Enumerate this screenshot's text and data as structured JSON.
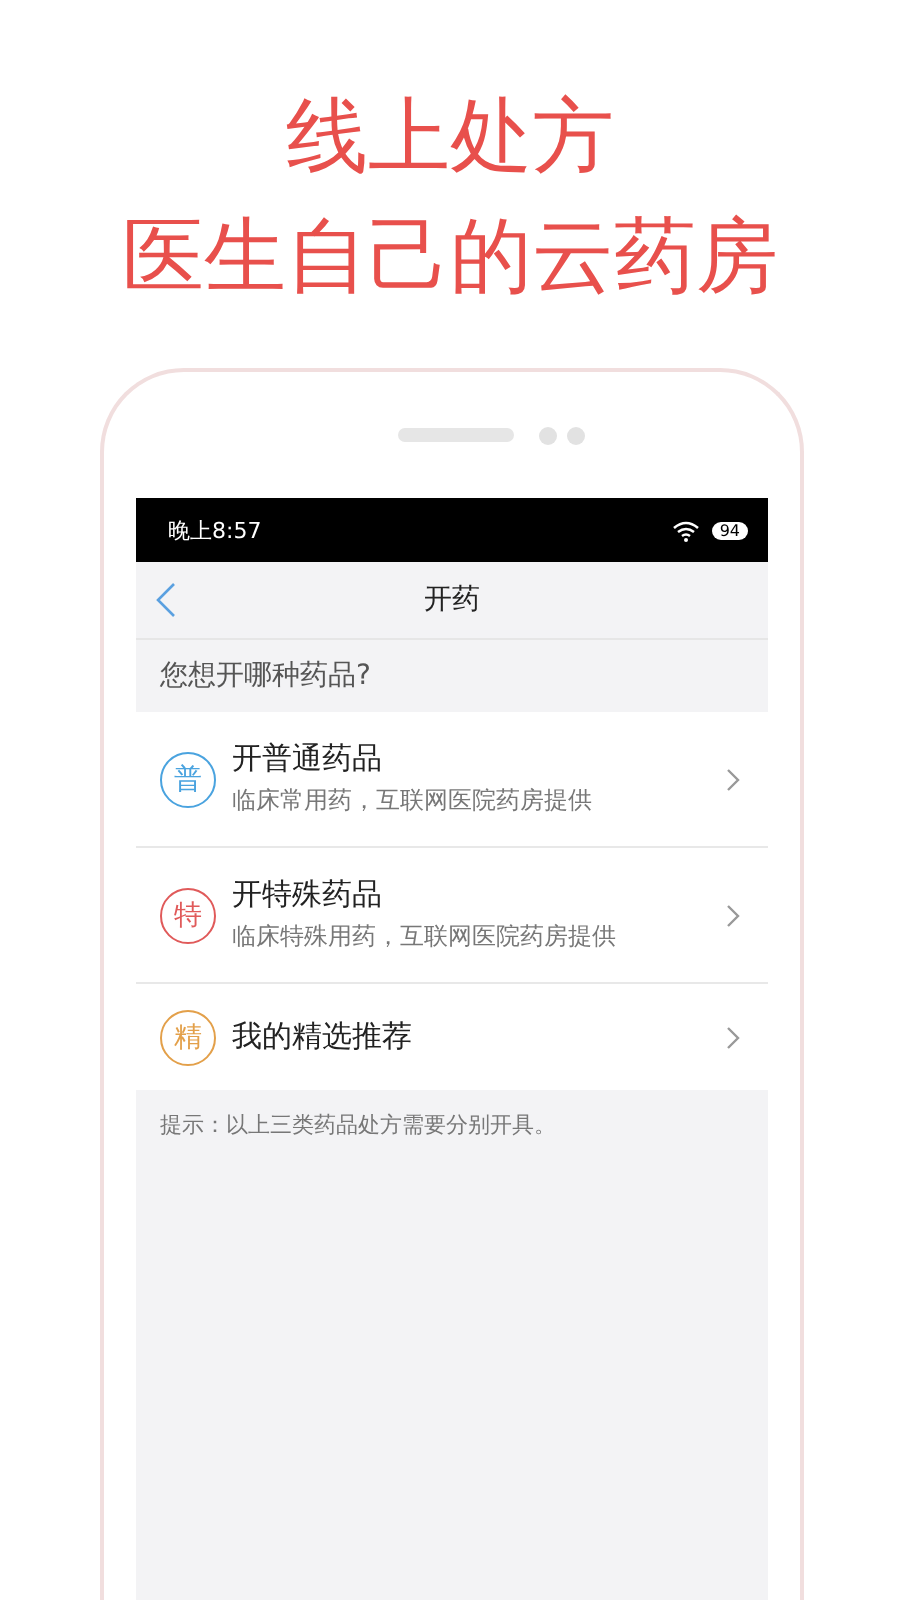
{
  "headline": [
    "线上处方",
    "医生自己的云药房"
  ],
  "status_bar": {
    "time": "晚上8:57",
    "battery": "94"
  },
  "nav": {
    "title": "开药"
  },
  "question": "您想开哪种药品?",
  "options": [
    {
      "badge": "普",
      "title": "开普通药品",
      "subtitle": "临床常用药，互联网医院药房提供",
      "color": "#4aa3df"
    },
    {
      "badge": "特",
      "title": "开特殊药品",
      "subtitle": "临床特殊用药，互联网医院药房提供",
      "color": "#e05a5a"
    },
    {
      "badge": "精",
      "title": "我的精选推荐",
      "color": "#e3a04a"
    }
  ],
  "hint": "提示：以上三类药品处方需要分别开具。"
}
